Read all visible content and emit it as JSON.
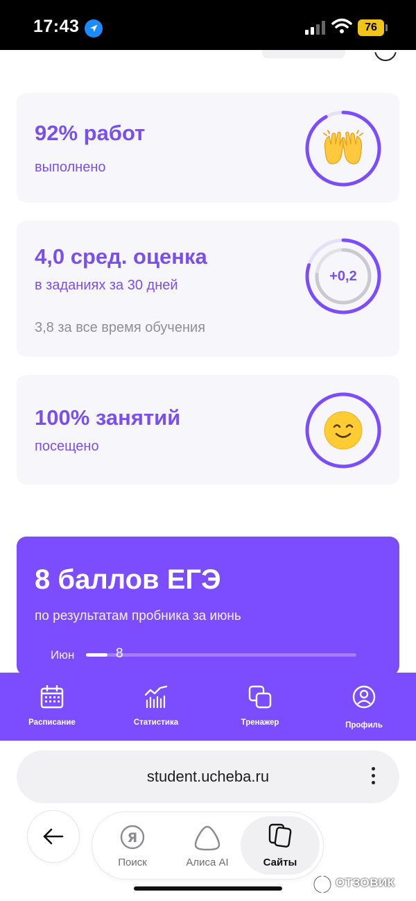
{
  "status_bar": {
    "time": "17:43",
    "battery": "76"
  },
  "stats": {
    "works": {
      "title": "92% работ",
      "subtitle": "выполнено",
      "percent": 92,
      "icon": "raising-hands-emoji"
    },
    "grade": {
      "title": "4,0 сред. оценка",
      "subtitle": "в заданиях за 30 дней",
      "note": "3,8 за все время обучения",
      "delta": "+0,2",
      "avg": 4.0,
      "overall": 3.8
    },
    "lessons": {
      "title": "100% занятий",
      "subtitle": "посещено",
      "percent": 100,
      "icon": "smiling-face-emoji"
    }
  },
  "ege": {
    "title": "8 баллов ЕГЭ",
    "subtitle": "по результатам пробника за июнь",
    "month": "Июн",
    "value": "8",
    "max_score": 100
  },
  "tabbar": {
    "items": [
      {
        "label": "Расписание",
        "icon": "calendar-icon"
      },
      {
        "label": "Статистика",
        "icon": "chart-icon"
      },
      {
        "label": "Тренажер",
        "icon": "cards-icon"
      },
      {
        "label": "Профиль",
        "icon": "profile-icon"
      }
    ]
  },
  "browser": {
    "url": "student.ucheba.ru",
    "nav": [
      {
        "label": "Поиск",
        "icon": "yandex-search-icon"
      },
      {
        "label": "Алиса AI",
        "icon": "alice-icon"
      },
      {
        "label": "Сайты",
        "icon": "sites-icon",
        "active": true
      }
    ]
  },
  "watermark": "ОТЗОВИК",
  "colors": {
    "accent": "#7c4dff",
    "card_bg": "#f6f6fb",
    "muted": "#8e8e96"
  }
}
